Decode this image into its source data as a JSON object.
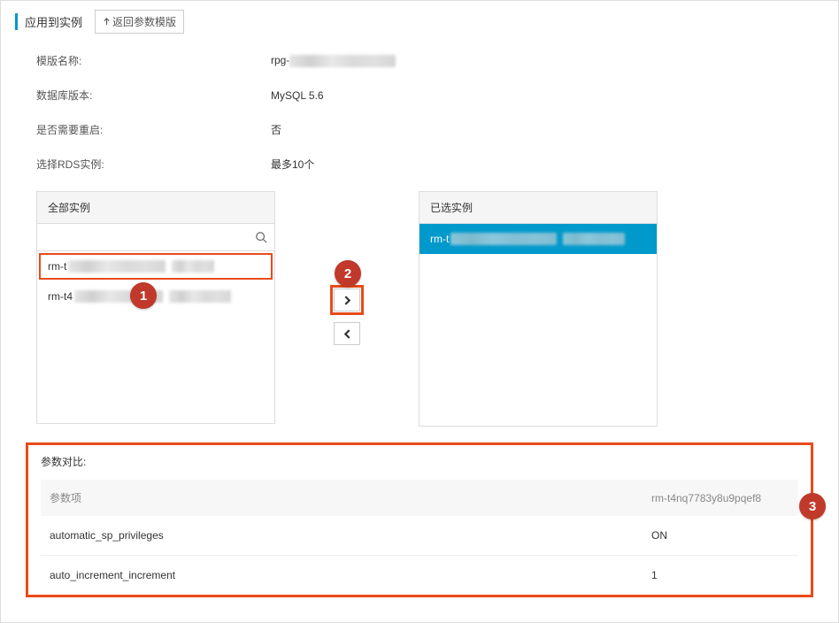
{
  "header": {
    "title": "应用到实例",
    "back_button": "返回参数模版"
  },
  "form": {
    "template_name_label": "模版名称:",
    "template_name_value": "rpg-",
    "db_version_label": "数据库版本:",
    "db_version_value": "MySQL 5.6",
    "need_restart_label": "是否需要重启:",
    "need_restart_value": "否",
    "select_rds_label": "选择RDS实例:",
    "select_rds_value": "最多10个"
  },
  "transfer": {
    "left_title": "全部实例",
    "right_title": "已选实例",
    "search_placeholder": "",
    "left_items": [
      {
        "prefix": "rm-t"
      },
      {
        "prefix": "rm-t4"
      }
    ],
    "right_items": [
      {
        "prefix": "rm-t"
      }
    ]
  },
  "callouts": {
    "one": "1",
    "two": "2",
    "three": "3"
  },
  "compare": {
    "title": "参数对比:",
    "col_param": "参数项",
    "col_instance": "rm-t4nq7783y8u9pqef8",
    "rows": [
      {
        "param": "automatic_sp_privileges",
        "value": "ON"
      },
      {
        "param": "auto_increment_increment",
        "value": "1"
      }
    ]
  }
}
